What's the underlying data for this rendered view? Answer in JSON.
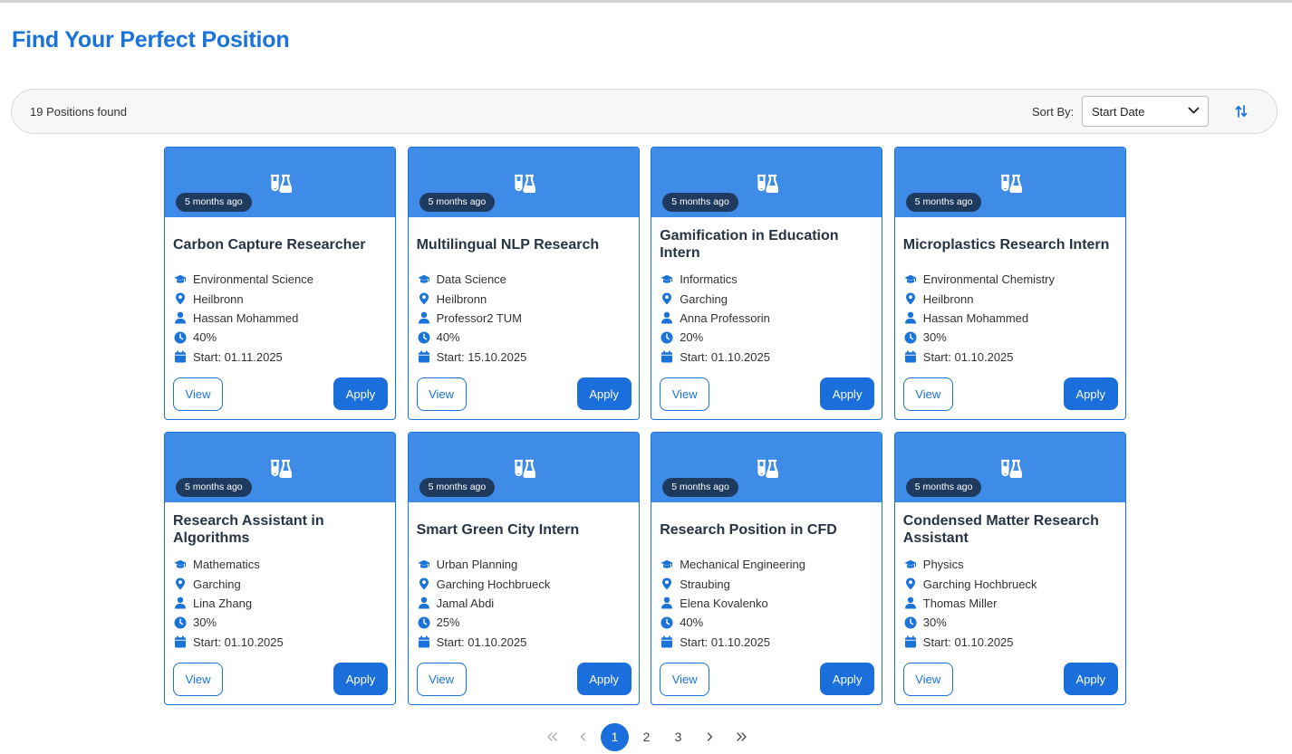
{
  "header": {
    "title": "Find Your Perfect Position"
  },
  "toolbar": {
    "results_text": "19 Positions found",
    "sort_label": "Sort By:",
    "sort_selected": "Start Date"
  },
  "positions": [
    {
      "posted": "5 months ago",
      "title": "Carbon Capture Researcher",
      "field": "Environmental Science",
      "location": "Heilbronn",
      "supervisor": "Hassan Mohammed",
      "workload": "40%",
      "start": "Start: 01.11.2025",
      "view_label": "View",
      "apply_label": "Apply"
    },
    {
      "posted": "5 months ago",
      "title": "Multilingual NLP Research",
      "field": "Data Science",
      "location": "Heilbronn",
      "supervisor": "Professor2 TUM",
      "workload": "40%",
      "start": "Start: 15.10.2025",
      "view_label": "View",
      "apply_label": "Apply"
    },
    {
      "posted": "5 months ago",
      "title": "Gamification in Education Intern",
      "field": "Informatics",
      "location": "Garching",
      "supervisor": "Anna Professorin",
      "workload": "20%",
      "start": "Start: 01.10.2025",
      "view_label": "View",
      "apply_label": "Apply"
    },
    {
      "posted": "5 months ago",
      "title": "Microplastics Research Intern",
      "field": "Environmental Chemistry",
      "location": "Heilbronn",
      "supervisor": "Hassan Mohammed",
      "workload": "30%",
      "start": "Start: 01.10.2025",
      "view_label": "View",
      "apply_label": "Apply"
    },
    {
      "posted": "5 months ago",
      "title": "Research Assistant in Algorithms",
      "field": "Mathematics",
      "location": "Garching",
      "supervisor": "Lina Zhang",
      "workload": "30%",
      "start": "Start: 01.10.2025",
      "view_label": "View",
      "apply_label": "Apply"
    },
    {
      "posted": "5 months ago",
      "title": "Smart Green City Intern",
      "field": "Urban Planning",
      "location": "Garching Hochbrueck",
      "supervisor": "Jamal Abdi",
      "workload": "25%",
      "start": "Start: 01.10.2025",
      "view_label": "View",
      "apply_label": "Apply"
    },
    {
      "posted": "5 months ago",
      "title": "Research Position in CFD",
      "field": "Mechanical Engineering",
      "location": "Straubing",
      "supervisor": "Elena Kovalenko",
      "workload": "40%",
      "start": "Start: 01.10.2025",
      "view_label": "View",
      "apply_label": "Apply"
    },
    {
      "posted": "5 months ago",
      "title": "Condensed Matter Research Assistant",
      "field": "Physics",
      "location": "Garching Hochbrueck",
      "supervisor": "Thomas Miller",
      "workload": "30%",
      "start": "Start: 01.10.2025",
      "view_label": "View",
      "apply_label": "Apply"
    }
  ],
  "pagination": {
    "first": "«",
    "prev": "‹",
    "pages": [
      "1",
      "2",
      "3"
    ],
    "current": "1",
    "next": "›",
    "last": "»"
  },
  "theme": {
    "accent": "#1a73d9",
    "banner": "#3f8ce8",
    "badge": "#1f3a5f"
  },
  "icons": {
    "banner": "flask-icon",
    "field": "graduation-cap-icon",
    "location": "map-pin-icon",
    "supervisor": "user-icon",
    "workload": "clock-icon",
    "start": "calendar-icon",
    "sort_direction": "sort-arrows-icon"
  }
}
